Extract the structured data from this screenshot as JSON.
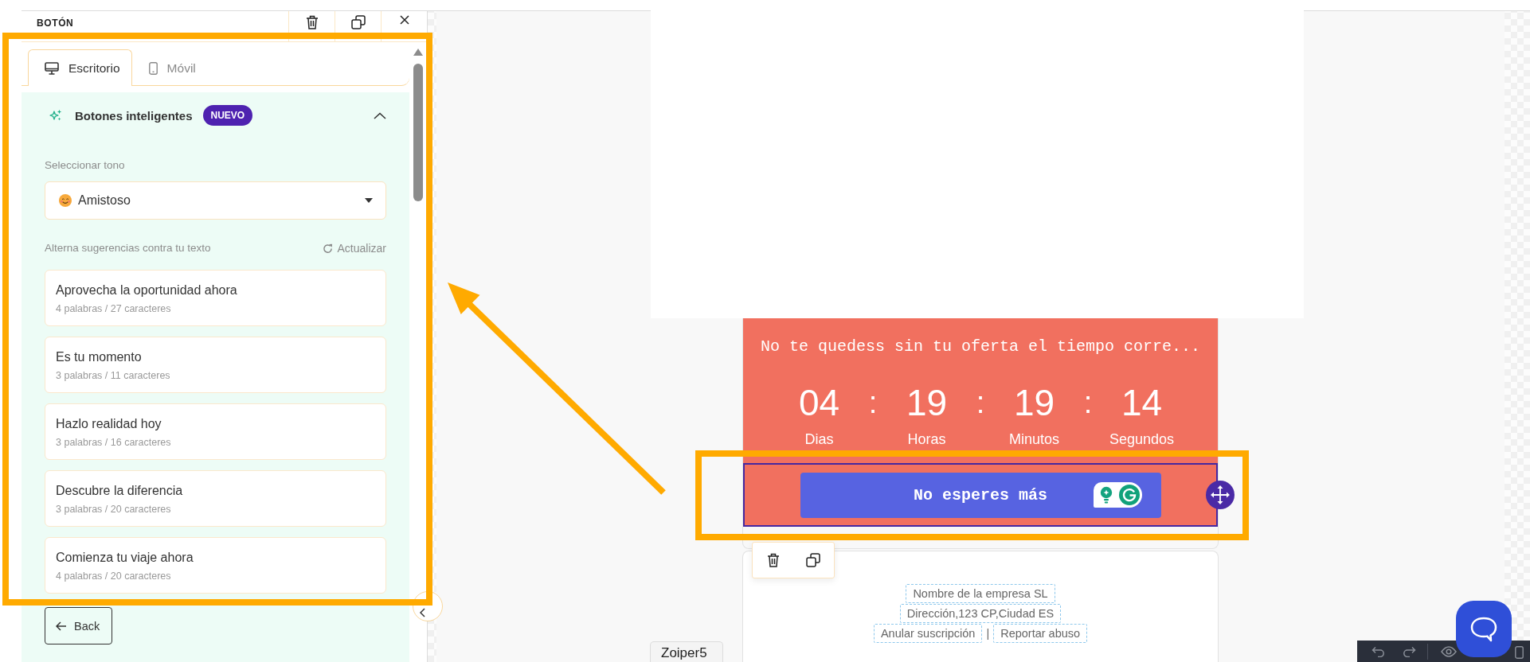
{
  "panel": {
    "title": "BOTÓN",
    "tabs": [
      {
        "label": "Escritorio",
        "kind": "desktop",
        "selected": true
      },
      {
        "label": "Móvil",
        "kind": "mobile",
        "selected": false
      }
    ],
    "smart_buttons": {
      "title": "Botones inteligentes",
      "badge": "NUEVO",
      "expanded": true,
      "tone_label": "Seleccionar tono",
      "tone": "Amistoso",
      "suggestions_label": "Alterna sugerencias contra tu texto",
      "refresh": "Actualizar",
      "suggestions": [
        {
          "text": "Aprovecha la oportunidad ahora",
          "meta": "4 palabras / 27 caracteres"
        },
        {
          "text": "Es tu momento",
          "meta": "3 palabras / 11 caracteres"
        },
        {
          "text": "Hazlo realidad hoy",
          "meta": "3 palabras / 16 caracteres"
        },
        {
          "text": "Descubre la diferencia",
          "meta": "3 palabras / 20 caracteres"
        },
        {
          "text": "Comienza tu viaje ahora",
          "meta": "4 palabras / 20 caracteres"
        }
      ]
    },
    "back": "Back"
  },
  "email": {
    "countdown": {
      "headline": "No te quedess sin tu oferta el tiempo corre...",
      "units": [
        {
          "value": "04",
          "label": "Dias"
        },
        {
          "value": "19",
          "label": "Horas"
        },
        {
          "value": "19",
          "label": "Minutos"
        },
        {
          "value": "14",
          "label": "Segundos"
        }
      ],
      "separators": [
        ":",
        ":",
        ":"
      ]
    },
    "cta": {
      "label": "No esperes más",
      "selected": true
    },
    "footer": {
      "company": "Nombre de la empresa SL",
      "address": "Dirección,123 CP,Ciudad ES",
      "links": [
        "Anular suscripción",
        "Reportar abuso"
      ],
      "separator": "|"
    }
  },
  "app_tab": "Zoiper5"
}
